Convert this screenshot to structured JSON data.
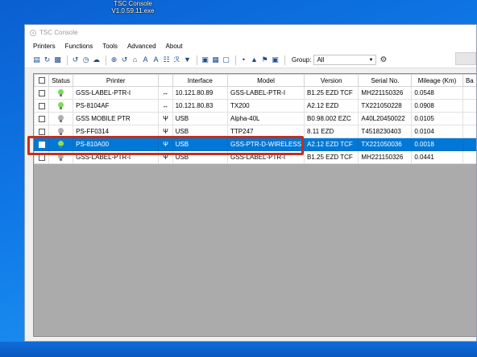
{
  "desktop": {
    "icon_label_line1": "TSC Console",
    "icon_label_line2": "V1.0.59.11.exe"
  },
  "window": {
    "title": "TSC Console",
    "menu": [
      "Printers",
      "Functions",
      "Tools",
      "Advanced",
      "About"
    ],
    "toolbar": {
      "group_label": "Group:",
      "group_value": "All"
    }
  },
  "table": {
    "columns": [
      "Status",
      "Printer",
      "",
      "Interface",
      "Model",
      "Version",
      "Serial No.",
      "Mileage (Km)",
      "Ba"
    ],
    "rows": [
      {
        "status": "online",
        "bulb_color": "#7ed957",
        "printer": "GSS-LABEL-PTR-I",
        "iface_icon": "<->",
        "interface": "10.121.80.89",
        "model": "GSS-LABEL-PTR-I",
        "version": "B1.25 EZD TCF",
        "serial": "MH221150326",
        "mileage": "0.0548",
        "selected": false
      },
      {
        "status": "online",
        "bulb_color": "#7ed957",
        "printer": "PS-8104AF",
        "iface_icon": "<->",
        "interface": "10.121.80.83",
        "model": "TX200",
        "version": "A2.12 EZD",
        "serial": "TX221050228",
        "mileage": "0.0908",
        "selected": false
      },
      {
        "status": "offline",
        "bulb_color": "#b0b0b0",
        "printer": "GSS MOBILE PTR",
        "iface_icon": "usb",
        "interface": "USB",
        "model": "Alpha-40L",
        "version": "B0.98.002 EZC",
        "serial": "A40L20450022",
        "mileage": "0.0105",
        "selected": false
      },
      {
        "status": "offline",
        "bulb_color": "#b0b0b0",
        "printer": "PS-FF0314",
        "iface_icon": "usb",
        "interface": "USB",
        "model": "TTP247",
        "version": "8.11 EZD",
        "serial": "T4518230403",
        "mileage": "0.0104",
        "selected": false
      },
      {
        "status": "online",
        "bulb_color": "#8fe05a",
        "printer": "PS-810A00",
        "iface_icon": "usb",
        "interface": "USB",
        "model": "GSS-PTR-D-WIRELESS",
        "version": "A2.12 EZD TCF",
        "serial": "TX221050036",
        "mileage": "0.0018",
        "selected": true
      },
      {
        "status": "offline",
        "bulb_color": "#b0b0b0",
        "printer": "GSS-LABEL-PTR-I",
        "iface_icon": "usb",
        "interface": "USB",
        "model": "GSS-LABEL-PTR-I",
        "version": "B1.25 EZD TCF",
        "serial": "MH221150326",
        "mileage": "0.0441",
        "selected": false
      }
    ]
  },
  "colors": {
    "selection": "#0078d7",
    "highlight_box": "#c2301d",
    "grid_background": "#ababab"
  }
}
